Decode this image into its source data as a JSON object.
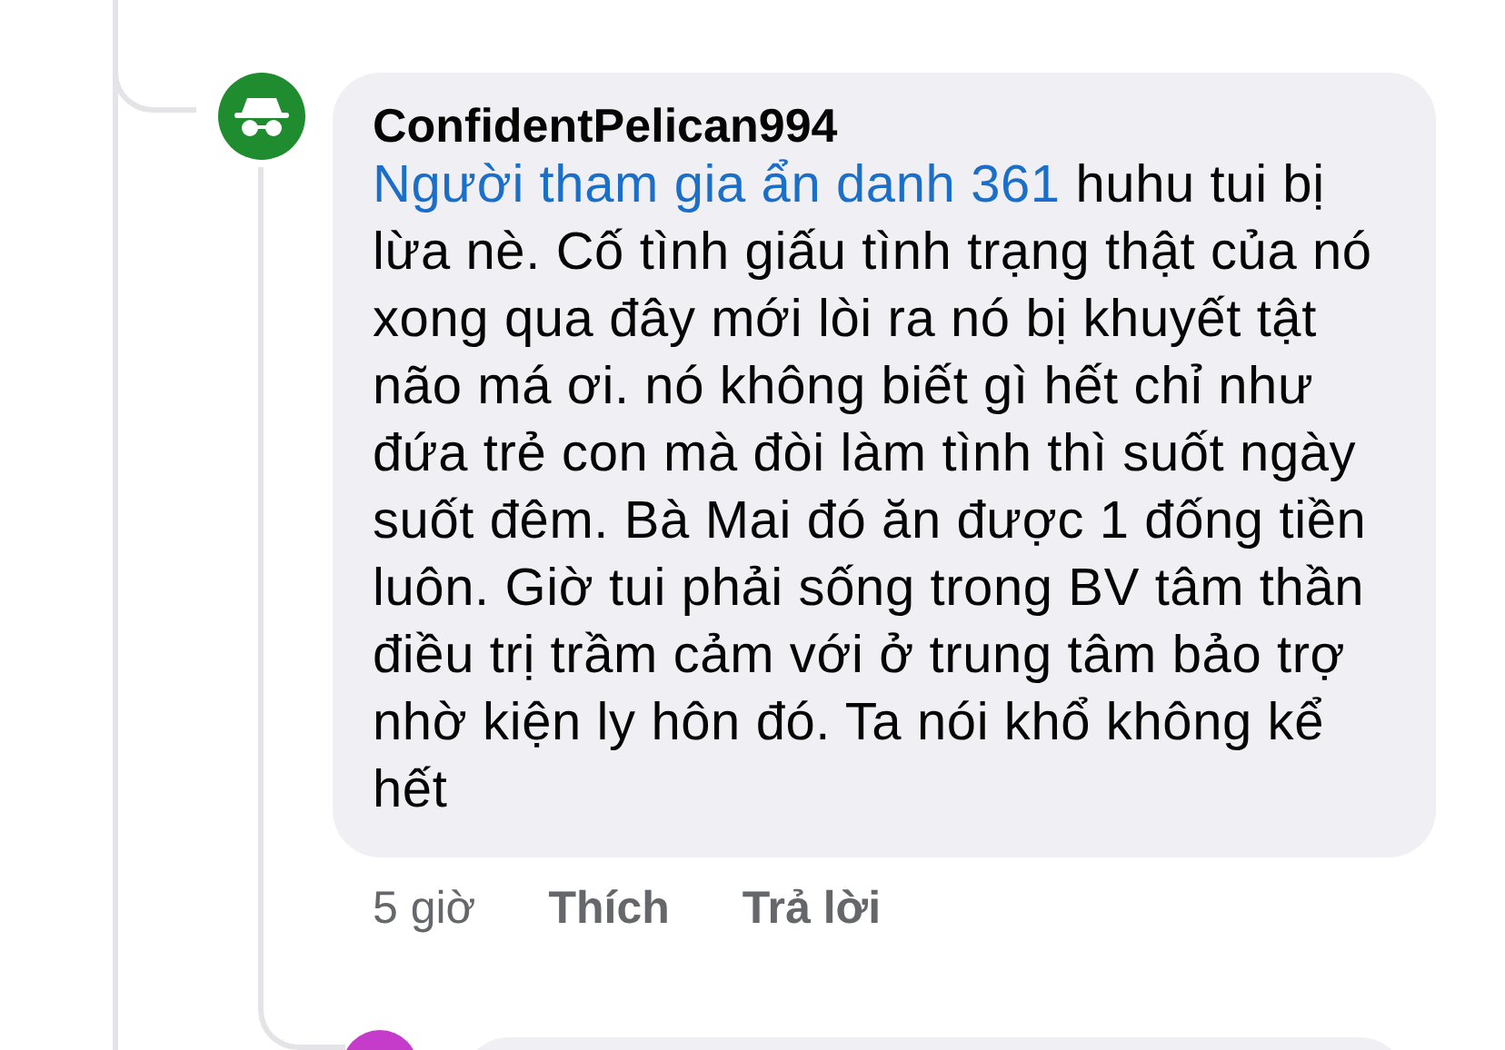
{
  "comments": [
    {
      "color": "#1e8c2f",
      "author": "ConfidentPelican994",
      "mention": "Người tham gia ẩn danh 361",
      "text": "huhu tui bị lừa nè. Cố tình giấu tình trạng thật của nó xong qua đây mới lòi ra nó bị khuyết tật não má ơi. nó không biết gì hết chỉ như đứa trẻ con mà đòi làm tình thì suốt ngày suốt đêm. Bà Mai đó ăn được 1 đống tiền luôn. Giờ tui phải sống trong BV tâm thần điều trị trầm cảm với ở trung tâm bảo trợ nhờ kiện ly hôn đó. Ta nói khổ không kể hết",
      "time": "5 giờ",
      "actions": [
        "Thích",
        "Trả lời"
      ]
    },
    {
      "color": "#c43cc9"
    }
  ]
}
